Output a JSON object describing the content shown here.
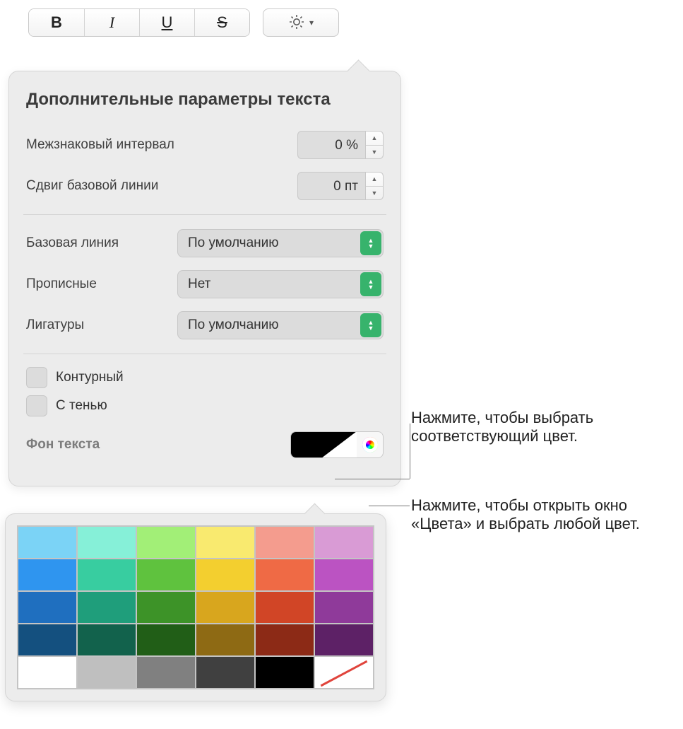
{
  "toolbar": {
    "bold": "B",
    "italic": "I",
    "underline": "U",
    "strike": "S"
  },
  "panel": {
    "title": "Дополнительные параметры текста",
    "character_spacing_label": "Межзнаковый интервал",
    "character_spacing_value": "0 %",
    "baseline_shift_label": "Сдвиг базовой линии",
    "baseline_shift_value": "0 пт",
    "baseline_label": "Базовая линия",
    "baseline_value": "По умолчанию",
    "caps_label": "Прописные",
    "caps_value": "Нет",
    "ligatures_label": "Лигатуры",
    "ligatures_value": "По умолчанию",
    "outline_label": "Контурный",
    "shadow_label": "С тенью",
    "text_bg_label": "Фон текста"
  },
  "callouts": {
    "swatch": "Нажмите, чтобы выбрать соответствующий цвет.",
    "wheel": "Нажмите, чтобы открыть окно «Цвета» и выбрать любой цвет."
  },
  "palette": {
    "rows": [
      [
        "#7bd3f6",
        "#86f0d8",
        "#a2ef77",
        "#f9ea6f",
        "#f49c8e",
        "#d99bd5"
      ],
      [
        "#2f95ef",
        "#38cda0",
        "#5fc23e",
        "#f3cf2f",
        "#ef6a45",
        "#bb53c2"
      ],
      [
        "#1f6fbf",
        "#1f9e7b",
        "#3d9328",
        "#d8a61e",
        "#d14526",
        "#8f3a9a"
      ],
      [
        "#14507f",
        "#12624c",
        "#215e17",
        "#8e6a14",
        "#8c2a16",
        "#5d2166"
      ],
      [
        "#ffffff",
        "#bfbfbf",
        "#808080",
        "#404040",
        "#000000",
        "none"
      ]
    ]
  }
}
